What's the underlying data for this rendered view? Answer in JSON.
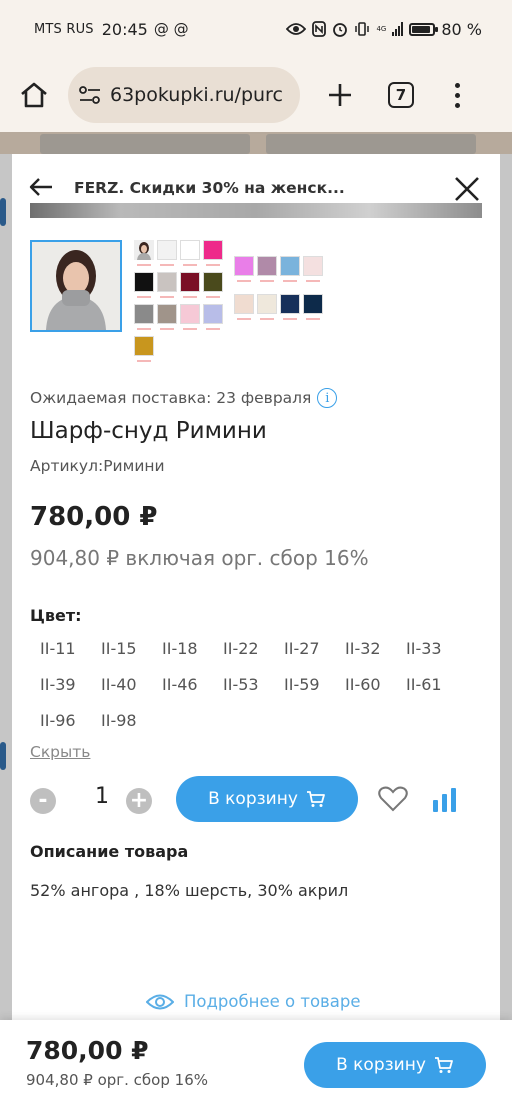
{
  "status_bar": {
    "carrier": "MTS RUS",
    "time": "20:45",
    "notif_icons": "@ @",
    "network": "4G",
    "battery": "80 %",
    "battery_level": 0.8
  },
  "browser": {
    "url": "63pokupki.ru/purc",
    "tab_count": "7"
  },
  "modal": {
    "title": "FERZ. Скидки 30% на женск...",
    "delivery": "Ожидаемая поставка: 23 февраля",
    "product_name": "Шарф-снуд Римини",
    "article": "Артикул:Римини",
    "price": "780,00 ₽",
    "price_full": "904,80 ₽ включая орг. сбор 16%",
    "color_label": "Цвет:",
    "color_codes": [
      "II-11",
      "II-15",
      "II-18",
      "II-22",
      "II-27",
      "II-32",
      "II-33",
      "II-39",
      "II-40",
      "II-46",
      "II-53",
      "II-59",
      "II-60",
      "II-61",
      "II-96",
      "II-98"
    ],
    "hide_link": "Скрыть",
    "quantity": "1",
    "minus": "-",
    "plus": "+",
    "add_to_cart": "В корзину",
    "description_title": "Описание товара",
    "description_text": "52% ангора , 18% шерсть, 30% акрил",
    "more_link": "Подробнее о товаре",
    "swatches_a": [
      "#f2f2f2",
      "#ffffff",
      "#ee2a8a",
      "#111111",
      "#c9c3c0",
      "#7a0f26",
      "#4a4a1c",
      "#8a8a8a",
      "#a0948a",
      "#f6c9d6",
      "#b8bde8",
      "#c8961e"
    ],
    "swatches_b": [
      "#e97ee8",
      "#b08aa8",
      "#7ab3dc",
      "#f4e0e0",
      "#f0dcd0",
      "#efe8dc",
      "#17305a",
      "#0d2a4a"
    ]
  },
  "bottom_bar": {
    "price": "780,00 ₽",
    "sub": "904,80 ₽ орг. сбор 16%",
    "add_to_cart": "В корзину"
  },
  "colors": {
    "accent": "#3aa0e8"
  }
}
